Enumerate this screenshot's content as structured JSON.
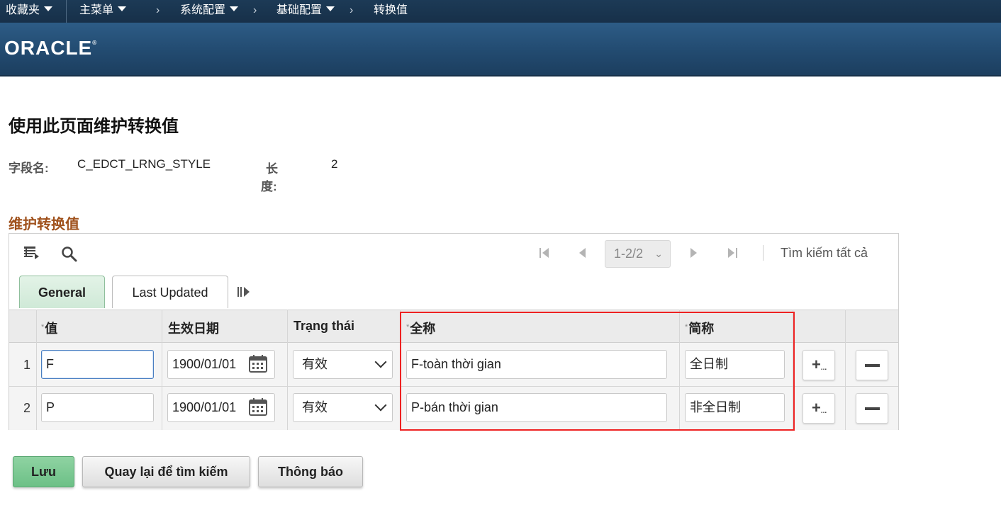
{
  "topnav": {
    "favorites": "收藏夹",
    "main_menu": "主菜单",
    "breadcrumb": [
      "系统配置",
      "基础配置",
      "转换值"
    ]
  },
  "brand": {
    "logo": "ORACLE",
    "mark": "®"
  },
  "page": {
    "title": "使用此页面维护转换值",
    "field_name_label": "字段名:",
    "field_name_value": "C_EDCT_LRNG_STYLE",
    "length_label_1": "长",
    "length_label_2": "度:",
    "length_value": "2"
  },
  "section": {
    "title": "维护转换值"
  },
  "grid": {
    "pager_text": "1-2/2",
    "search_all": "Tìm kiếm tất cả",
    "tabs": [
      "General",
      "Last Updated"
    ],
    "req_mark": "*",
    "columns": [
      "值",
      "生效日期",
      "Trạng thái",
      "全称",
      "简称"
    ],
    "rows": [
      {
        "num": "1",
        "value": "F",
        "date": "1900/01/01",
        "status": "有效",
        "full": "F-toàn thời gian",
        "short": "全日制"
      },
      {
        "num": "2",
        "value": "P",
        "date": "1900/01/01",
        "status": "有效",
        "full": "P-bán thời gian",
        "short": "非全日制"
      }
    ],
    "add_label": "+",
    "add_suffix": "..."
  },
  "actions": {
    "save": "Lưu",
    "back": "Quay lại để tìm kiếm",
    "notify": "Thông báo"
  },
  "colors": {
    "highlight_box": "#e22222",
    "section_title": "#a0521d",
    "save_button": "#6cc086"
  }
}
